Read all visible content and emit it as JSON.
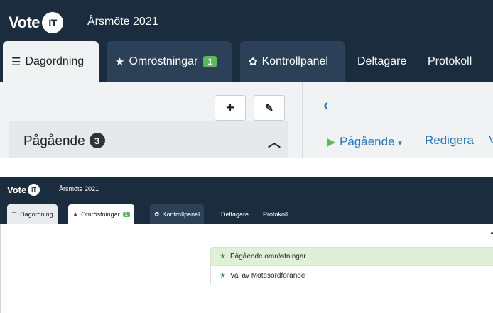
{
  "brand": {
    "logo_text": "Vote",
    "logo_badge": "IT"
  },
  "meeting": {
    "title": "Årsmöte 2021"
  },
  "tabs": [
    {
      "label": "Dagordning",
      "icon": "list-icon"
    },
    {
      "label": "Omröstningar",
      "icon": "star-icon",
      "badge": "1"
    },
    {
      "label": "Kontrollpanel",
      "icon": "gear-icon"
    },
    {
      "label": "Deltagare"
    },
    {
      "label": "Protokoll"
    }
  ],
  "toolbar": {
    "add_label": "+",
    "edit_icon": "edit-icon"
  },
  "sidebar": {
    "section_label": "Pågående",
    "section_count": "3"
  },
  "main": {
    "back_chevron": "‹",
    "status_link": "Pågående",
    "edit_link": "Redigera",
    "edit_link_next": "V"
  },
  "polls": {
    "header": "Pågående omröstningar",
    "items": [
      "Val av Mötesordförande"
    ]
  },
  "colors": {
    "navbar": "#1b2c3e",
    "tab_dark": "#2c4157",
    "badge_green": "#5cb85c",
    "link_blue": "#2a78b5",
    "success_bg": "#dff0d8"
  }
}
